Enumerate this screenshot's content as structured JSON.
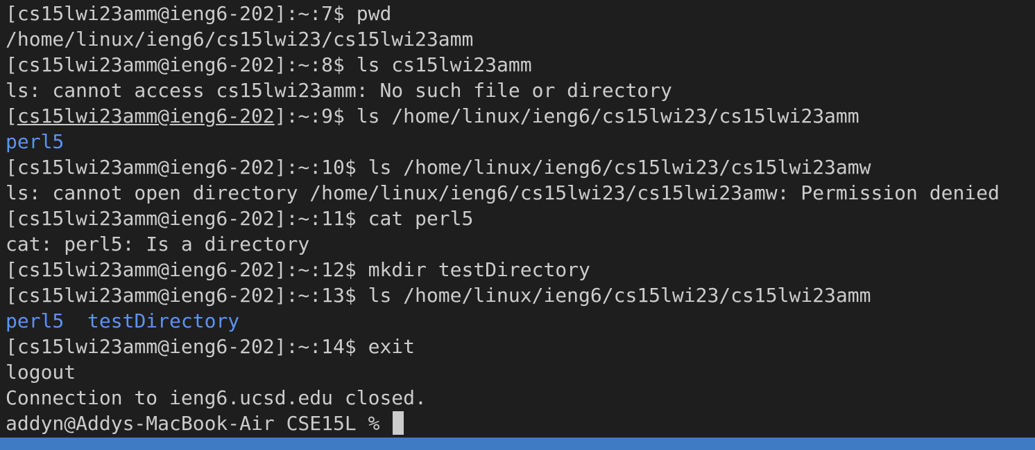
{
  "terminal": {
    "lines": [
      {
        "prompt": "[cs15lwi23amm@ieng6-202]:~:7$",
        "command": " pwd"
      },
      {
        "output": "/home/linux/ieng6/cs15lwi23/cs15lwi23amm"
      },
      {
        "prompt": "[cs15lwi23amm@ieng6-202]:~:8$",
        "command": " ls cs15lwi23amm"
      },
      {
        "output": "ls: cannot access cs15lwi23amm: No such file or directory"
      },
      {
        "prompt_open": "[",
        "prompt_user": "cs15lwi23amm@ieng6-202",
        "prompt_close": "]:~:9$",
        "command": " ls /home/linux/ieng6/cs15lwi23/cs15lwi23amm"
      },
      {
        "dirs": [
          "perl5"
        ]
      },
      {
        "prompt": "[cs15lwi23amm@ieng6-202]:~:10$",
        "command": " ls /home/linux/ieng6/cs15lwi23/cs15lwi23amw"
      },
      {
        "output": "ls: cannot open directory /home/linux/ieng6/cs15lwi23/cs15lwi23amw: Permission denied"
      },
      {
        "prompt": "[cs15lwi23amm@ieng6-202]:~:11$",
        "command": " cat perl5"
      },
      {
        "output": "cat: perl5: Is a directory"
      },
      {
        "prompt": "[cs15lwi23amm@ieng6-202]:~:12$",
        "command": " mkdir testDirectory"
      },
      {
        "prompt": "[cs15lwi23amm@ieng6-202]:~:13$",
        "command": " ls /home/linux/ieng6/cs15lwi23/cs15lwi23amm"
      },
      {
        "dirs": [
          "perl5",
          "testDirectory"
        ]
      },
      {
        "prompt": "[cs15lwi23amm@ieng6-202]:~:14$",
        "command": " exit"
      },
      {
        "output": "logout"
      },
      {
        "output": "Connection to ieng6.ucsd.edu closed."
      },
      {
        "local_prompt": "addyn@Addys-MacBook-Air CSE15L % "
      }
    ]
  },
  "colors": {
    "background": "#1e1e1e",
    "text": "#cccccc",
    "directory": "#5c93f5",
    "status_bar": "#3f7ac4"
  }
}
